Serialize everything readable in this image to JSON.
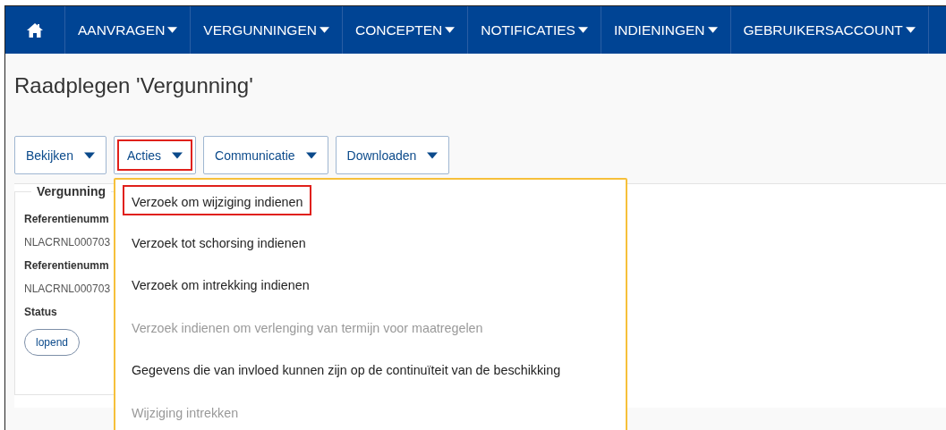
{
  "nav": {
    "items": [
      {
        "label": "AANVRAGEN"
      },
      {
        "label": "VERGUNNINGEN"
      },
      {
        "label": "CONCEPTEN"
      },
      {
        "label": "NOTIFICATIES"
      },
      {
        "label": "INDIENINGEN"
      },
      {
        "label": "GEBRUIKERSACCOUNT"
      }
    ]
  },
  "title": "Raadplegen 'Vergunning'",
  "toolbar": [
    {
      "label": "Bekijken",
      "highlighted": false
    },
    {
      "label": "Acties",
      "highlighted": true,
      "menu": [
        {
          "label": "Verzoek om wijziging indienen",
          "disabled": false,
          "highlighted": true
        },
        {
          "label": "Verzoek tot schorsing indienen",
          "disabled": false,
          "highlighted": false
        },
        {
          "label": "Verzoek om intrekking indienen",
          "disabled": false,
          "highlighted": false
        },
        {
          "label": "Verzoek indienen om verlenging van termijn voor maatregelen",
          "disabled": true,
          "highlighted": false
        },
        {
          "label": "Gegevens die van invloed kunnen zijn op de continuïteit van de beschikking",
          "disabled": false,
          "highlighted": false
        },
        {
          "label": "Wijziging intrekken",
          "disabled": true,
          "highlighted": false
        }
      ]
    },
    {
      "label": "Communicatie",
      "highlighted": false
    },
    {
      "label": "Downloaden",
      "highlighted": false
    }
  ],
  "panel": {
    "legend": "Vergunning",
    "fields": [
      {
        "label": "Referentienumm",
        "value": "NLACRNL000703"
      },
      {
        "label": "Referentienumm",
        "value": "NLACRNL000703"
      }
    ],
    "status_label": "Status",
    "status": "lopend"
  }
}
